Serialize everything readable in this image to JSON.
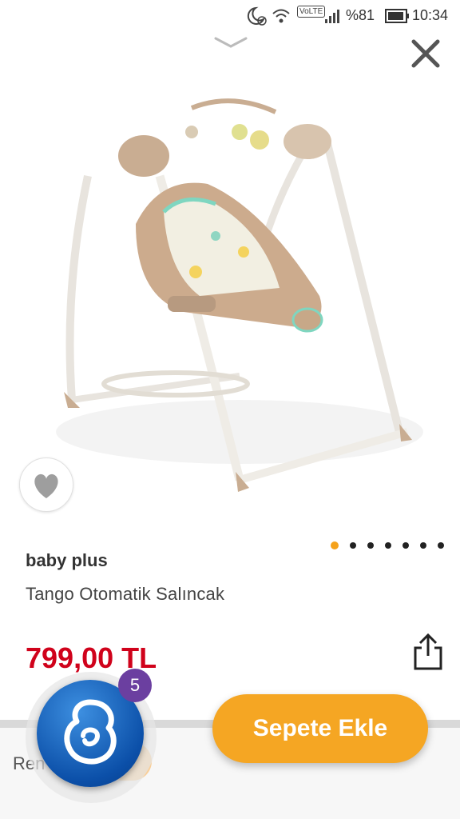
{
  "status_bar": {
    "battery_percent": "%81",
    "time": "10:34",
    "network_label": "VoLTE"
  },
  "product": {
    "brand": "baby plus",
    "title": "Tango Otomatik Salıncak",
    "price": "799,00 TL",
    "image_pager": {
      "count": 7,
      "active_index": 0
    }
  },
  "actions": {
    "add_to_cart": "Sepete Ekle",
    "bottom_label": "Ren",
    "ghost_label": "e"
  },
  "assistant": {
    "badge_count": "5"
  },
  "colors": {
    "accent": "#f5a623",
    "price": "#d0021b",
    "badge": "#6b3fa0",
    "assistant_blue": "#0b4fa8"
  },
  "icons": [
    "moon-alarm-icon",
    "wifi-icon",
    "volte-icon",
    "signal-icon",
    "battery-icon",
    "chevron-down-icon",
    "close-icon",
    "heart-icon",
    "share-icon",
    "assistant-logo-icon"
  ]
}
